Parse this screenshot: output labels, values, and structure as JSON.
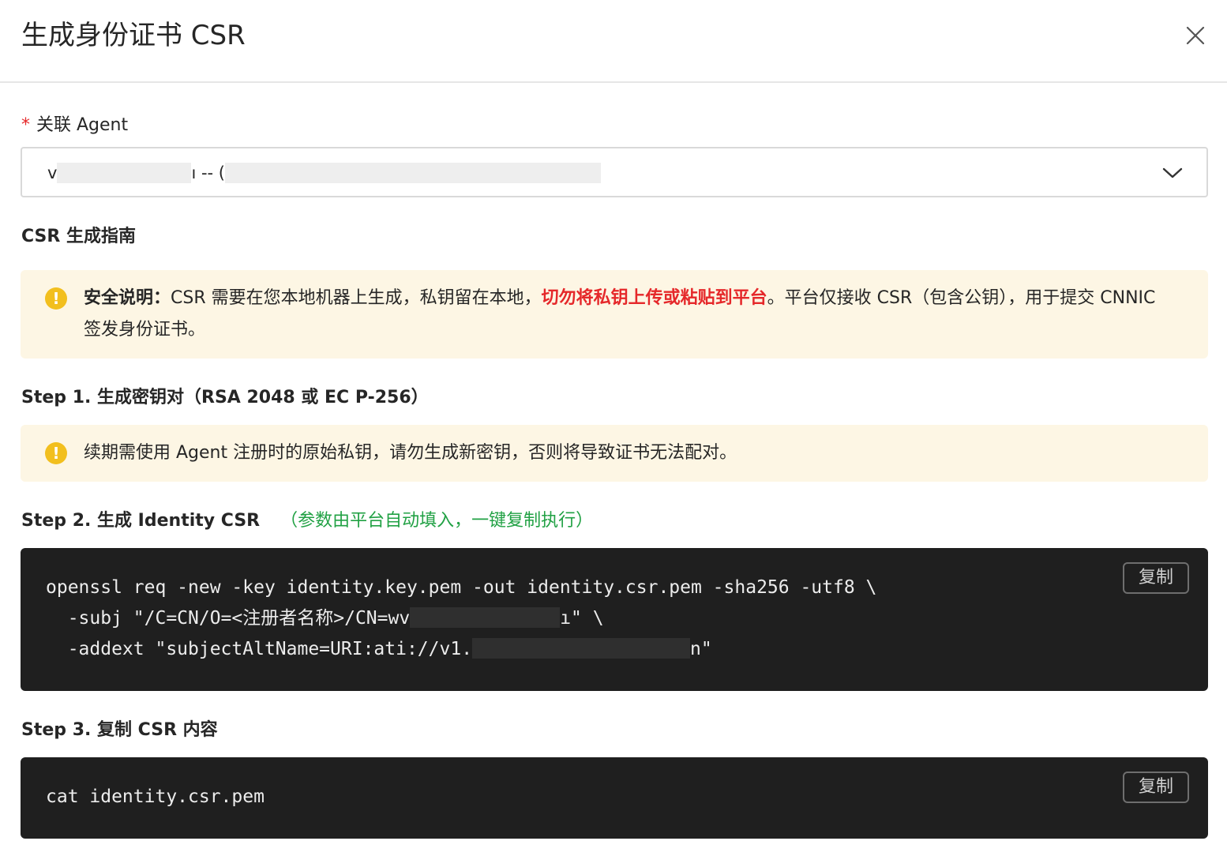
{
  "dialog": {
    "title": "生成身份证书 CSR",
    "close_icon": "close-icon"
  },
  "agent_field": {
    "required_mark": "*",
    "label": "关联 Agent",
    "value_prefix": "v",
    "value_middle": "ı -- (",
    "chevron_icon": "chevron-down-icon"
  },
  "guide": {
    "title": "CSR 生成指南"
  },
  "security_alert": {
    "icon": "warning-icon",
    "bold_label": "安全说明",
    "colon": "：",
    "text_before": "CSR 需要在您本地机器上生成，私钥留在本地，",
    "danger_text": "切勿将私钥上传或粘贴到平台",
    "text_after": "。平台仅接收 CSR（包含公钥），用于提交 CNNIC 签发身份证书。"
  },
  "step1": {
    "title": "Step 1. 生成密钥对（RSA 2048 或 EC P-256）"
  },
  "renew_alert": {
    "icon": "warning-icon",
    "text": "续期需使用 Agent 注册时的原始私钥，请勿生成新密钥，否则将导致证书无法配对。"
  },
  "step2": {
    "title": "Step 2. 生成 Identity CSR",
    "hint": "（参数由平台自动填入，一键复制执行）",
    "copy_label": "复制",
    "code_line1": "openssl req -new -key identity.key.pem -out identity.csr.pem -sha256 -utf8 \\",
    "code_line2_start": "  -subj \"/C=CN/O=<注册者名称>/CN=wv",
    "code_line2_end": "ı\" \\",
    "code_line3_start": "  -addext \"subjectAltName=URI:ati://v1.",
    "code_line3_end": "n\""
  },
  "step3": {
    "title": "Step 3. 复制 CSR 内容",
    "copy_label": "复制",
    "code_line1": "cat identity.csr.pem"
  },
  "colors": {
    "danger": "#e5282a",
    "success": "#21a144",
    "warning": "#f2bf1e",
    "alert_bg": "#fdf6e4",
    "code_bg": "#1f1f1f"
  }
}
